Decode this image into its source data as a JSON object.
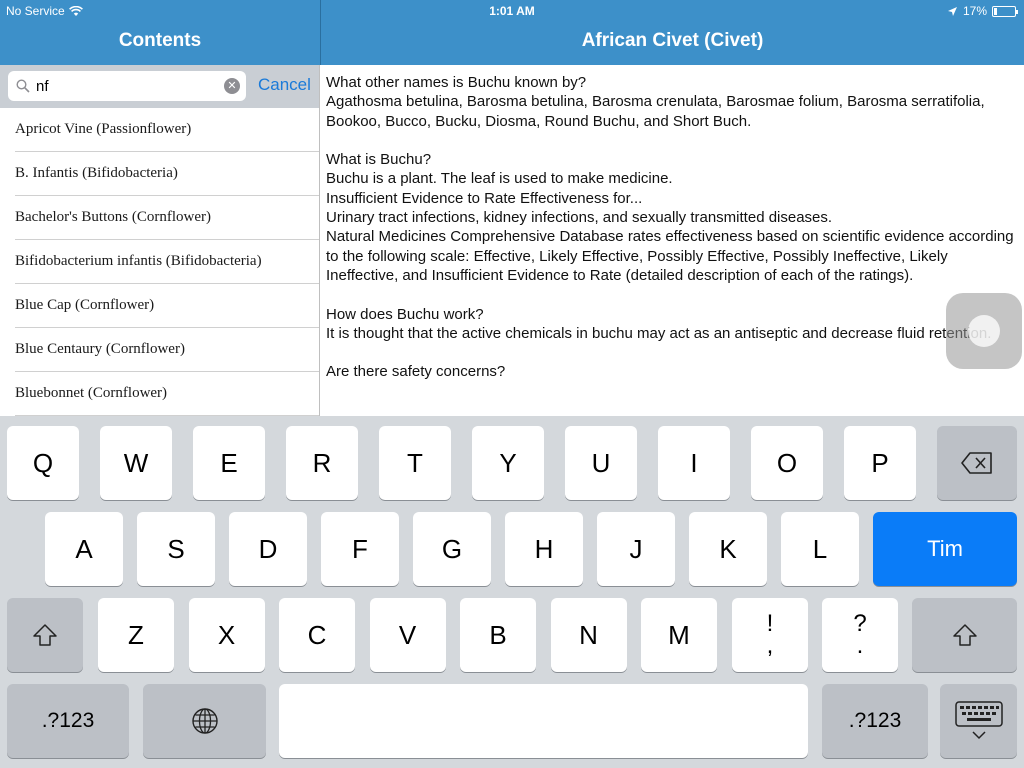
{
  "status": {
    "carrier": "No Service",
    "time": "1:01 AM",
    "battery": "17%",
    "battery_level": 0.17
  },
  "sidebar": {
    "title": "Contents",
    "search": {
      "value": "nf",
      "cancel": "Cancel"
    },
    "items": [
      "Apricot Vine (Passionflower)",
      "B. Infantis (Bifidobacteria)",
      "Bachelor's Buttons (Cornflower)",
      "Bifidobacterium infantis (Bifidobacteria)",
      "Blue Cap (Cornflower)",
      "Blue Centaury (Cornflower)",
      "Bluebonnet (Cornflower)"
    ]
  },
  "detail": {
    "title": "African Civet (Civet)",
    "paragraphs": [
      [
        "What other names is Buchu known by?",
        "Agathosma betulina, Barosma betulina, Barosma crenulata, Barosmae folium, Barosma serratifolia, Bookoo, Bucco, Bucku, Diosma, Round Buchu, and Short Buch."
      ],
      [
        "What is Buchu?",
        "Buchu is a plant. The leaf is used to make medicine.",
        "Insufficient Evidence to Rate Effectiveness for...",
        "Urinary tract infections, kidney infections, and sexually transmitted diseases.",
        "Natural Medicines Comprehensive Database rates effectiveness based on scientific evidence according to the following scale: Effective, Likely Effective, Possibly Effective, Possibly Ineffective, Likely Ineffective, and Insufficient Evidence to Rate (detailed description of each of the ratings)."
      ],
      [
        "How does Buchu work?",
        "It is thought that the active chemicals in buchu may act as an antiseptic and decrease fluid retention."
      ],
      [
        "Are there safety concerns?"
      ]
    ]
  },
  "keyboard": {
    "row1": [
      "Q",
      "W",
      "E",
      "R",
      "T",
      "Y",
      "U",
      "I",
      "O",
      "P"
    ],
    "row2": [
      "A",
      "S",
      "D",
      "F",
      "G",
      "H",
      "J",
      "K",
      "L"
    ],
    "row3": [
      "Z",
      "X",
      "C",
      "V",
      "B",
      "N",
      "M"
    ],
    "return_label": "Tim",
    "punct1": [
      "!",
      ","
    ],
    "punct2": [
      "?",
      "."
    ],
    "numbers_label": ".?123"
  },
  "colors": {
    "nav": "#3d90c9",
    "accent": "#1a7ad9",
    "return_key": "#0a7cf8"
  }
}
